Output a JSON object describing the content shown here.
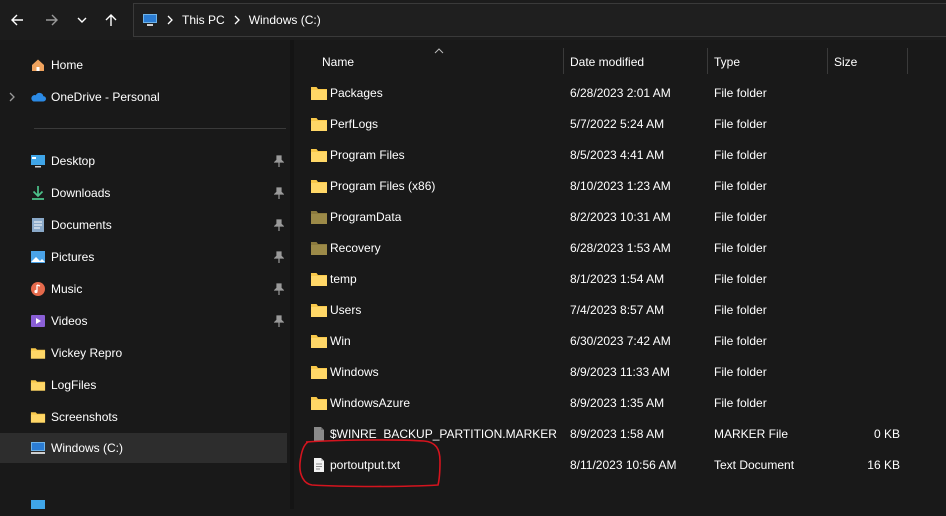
{
  "address_bar": {
    "crumbs": [
      "This PC",
      "Windows (C:)"
    ]
  },
  "sidebar": {
    "home": "Home",
    "onedrive": "OneDrive - Personal",
    "quick": [
      {
        "label": "Desktop",
        "icon": "desktop-icon",
        "pinned": true
      },
      {
        "label": "Downloads",
        "icon": "downloads-icon",
        "pinned": true
      },
      {
        "label": "Documents",
        "icon": "documents-icon",
        "pinned": true
      },
      {
        "label": "Pictures",
        "icon": "pictures-icon",
        "pinned": true
      },
      {
        "label": "Music",
        "icon": "music-icon",
        "pinned": true
      },
      {
        "label": "Videos",
        "icon": "videos-icon",
        "pinned": true
      },
      {
        "label": "Vickey Repro",
        "icon": "folder-icon",
        "pinned": false
      },
      {
        "label": "LogFiles",
        "icon": "folder-icon",
        "pinned": false
      },
      {
        "label": "Screenshots",
        "icon": "folder-icon",
        "pinned": false
      },
      {
        "label": "Windows (C:)",
        "icon": "drive-icon",
        "pinned": false
      }
    ]
  },
  "columns": {
    "name": "Name",
    "date": "Date modified",
    "type": "Type",
    "size": "Size"
  },
  "files": [
    {
      "name": "Packages",
      "date": "6/28/2023 2:01 AM",
      "type": "File folder",
      "size": "",
      "kind": "folder"
    },
    {
      "name": "PerfLogs",
      "date": "5/7/2022 5:24 AM",
      "type": "File folder",
      "size": "",
      "kind": "folder"
    },
    {
      "name": "Program Files",
      "date": "8/5/2023 4:41 AM",
      "type": "File folder",
      "size": "",
      "kind": "folder"
    },
    {
      "name": "Program Files (x86)",
      "date": "8/10/2023 1:23 AM",
      "type": "File folder",
      "size": "",
      "kind": "folder"
    },
    {
      "name": "ProgramData",
      "date": "8/2/2023 10:31 AM",
      "type": "File folder",
      "size": "",
      "kind": "folder-hidden"
    },
    {
      "name": "Recovery",
      "date": "6/28/2023 1:53 AM",
      "type": "File folder",
      "size": "",
      "kind": "folder-hidden"
    },
    {
      "name": "temp",
      "date": "8/1/2023 1:54 AM",
      "type": "File folder",
      "size": "",
      "kind": "folder"
    },
    {
      "name": "Users",
      "date": "7/4/2023 8:57 AM",
      "type": "File folder",
      "size": "",
      "kind": "folder"
    },
    {
      "name": "Win",
      "date": "6/30/2023 7:42 AM",
      "type": "File folder",
      "size": "",
      "kind": "folder"
    },
    {
      "name": "Windows",
      "date": "8/9/2023 11:33 AM",
      "type": "File folder",
      "size": "",
      "kind": "folder"
    },
    {
      "name": "WindowsAzure",
      "date": "8/9/2023 1:35 AM",
      "type": "File folder",
      "size": "",
      "kind": "folder"
    },
    {
      "name": "$WINRE_BACKUP_PARTITION.MARKER",
      "date": "8/9/2023 1:58 AM",
      "type": "MARKER File",
      "size": "0 KB",
      "kind": "file-hidden"
    },
    {
      "name": "portoutput.txt",
      "date": "8/11/2023 10:56 AM",
      "type": "Text Document",
      "size": "16 KB",
      "kind": "file"
    }
  ],
  "colors": {
    "folder": "#f8c84a",
    "folder_hidden": "#8b7a3e",
    "annotation": "#d4141e",
    "selected_bg": "#2d2d2d"
  }
}
